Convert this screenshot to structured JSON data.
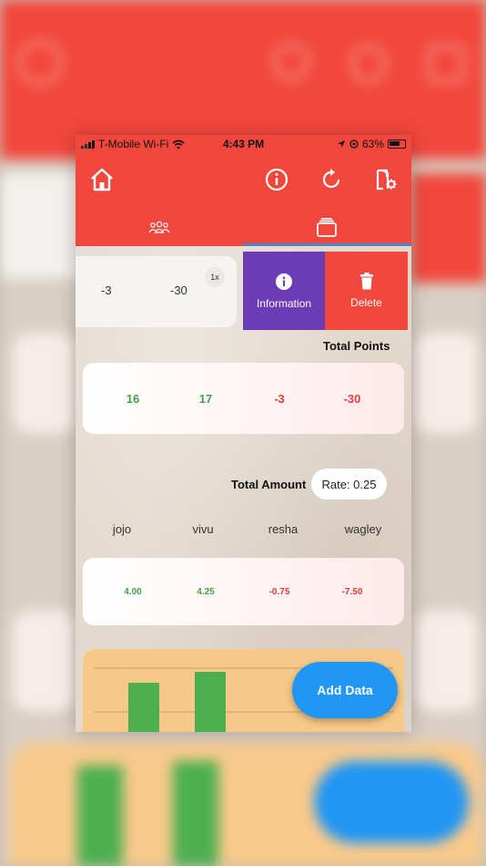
{
  "status_bar": {
    "carrier": "T-Mobile Wi-Fi",
    "time": "4:43 PM",
    "battery": "63%"
  },
  "app_bar": {
    "icons": [
      "home-icon",
      "info-icon",
      "refresh-icon",
      "settings-icon"
    ],
    "tabs": [
      {
        "icon": "group-icon",
        "selected": false
      },
      {
        "icon": "cards-icon",
        "selected": true
      }
    ]
  },
  "round_row": {
    "values": [
      "-3",
      "-30"
    ],
    "multiplier": "1x",
    "actions": {
      "information": "Information",
      "delete": "Delete"
    }
  },
  "total_points": {
    "label": "Total Points",
    "values": [
      "16",
      "17",
      "-3",
      "-30"
    ]
  },
  "total_amount": {
    "label": "Total Amount",
    "rate": "Rate: 0.25",
    "players": [
      "jojo",
      "vivu",
      "resha",
      "wagley"
    ],
    "values": [
      "4.00",
      "4.25",
      "-0.75",
      "-7.50"
    ]
  },
  "chart_data": {
    "type": "bar",
    "values": [
      16,
      17
    ]
  },
  "fab": {
    "label": "Add Data"
  },
  "colors": {
    "primary": "#f2473c",
    "info_button": "#6c3bb6",
    "positive": "#43a047",
    "negative": "#e53935",
    "fab": "#2196f3",
    "chart_bg": "#f8c888",
    "bar": "#4caf50"
  }
}
